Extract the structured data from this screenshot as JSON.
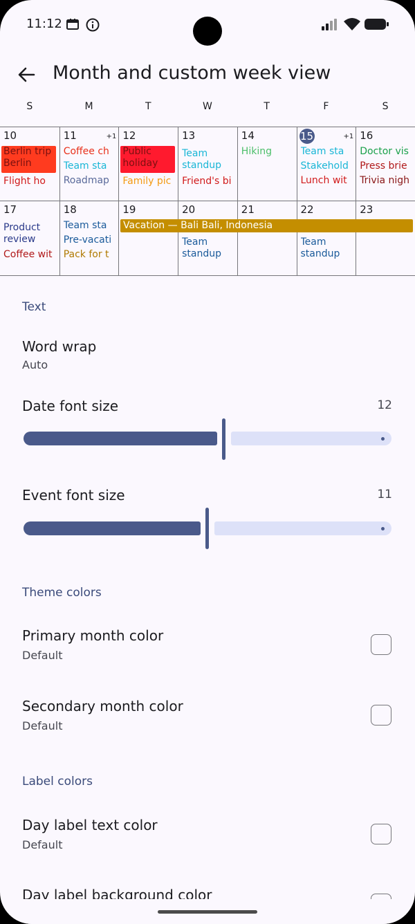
{
  "status": {
    "time": "11:12"
  },
  "header": {
    "title": "Month and custom week view"
  },
  "weekdays": [
    "S",
    "M",
    "T",
    "W",
    "T",
    "F",
    "S"
  ],
  "week1": {
    "days": [
      "10",
      "11",
      "12",
      "13",
      "14",
      "15",
      "16"
    ],
    "more_11": "+1",
    "more_15": "+1",
    "d10": {
      "box": "Berlin trip Berlin",
      "e1": "Flight ho"
    },
    "d11": {
      "e1": "Coffee ch",
      "e2": "Team sta",
      "e3": "Roadmap"
    },
    "d12": {
      "box": "Public holiday",
      "e1": "Family pic"
    },
    "d13": {
      "e1": "Team standup",
      "e2": "Friend's bi"
    },
    "d14": {
      "e1": "Hiking"
    },
    "d15": {
      "e1": "Team sta",
      "e2": "Stakehold",
      "e3": "Lunch wit"
    },
    "d16": {
      "e1": "Doctor vis",
      "e2": "Press brie",
      "e3": "Trivia nigh"
    }
  },
  "week2": {
    "days": [
      "17",
      "18",
      "19",
      "20",
      "21",
      "22",
      "23"
    ],
    "span_event": "Vacation — Bali Bali, Indonesia",
    "d17": {
      "e1": "Product review",
      "e2": "Coffee wit"
    },
    "d18": {
      "e1": "Team sta",
      "e2": "Pre-vacati",
      "e3": "Pack for t"
    },
    "d20": {
      "e1": "Team standup"
    },
    "d22": {
      "e1": "Team standup"
    }
  },
  "settings": {
    "text_section": "Text",
    "word_wrap": {
      "title": "Word wrap",
      "value": "Auto"
    },
    "date_font": {
      "title": "Date font size",
      "value": "12",
      "fraction": 0.55
    },
    "event_font": {
      "title": "Event font size",
      "value": "11",
      "fraction": 0.5
    },
    "theme_section": "Theme colors",
    "primary": {
      "title": "Primary month color",
      "value": "Default"
    },
    "secondary": {
      "title": "Secondary month color",
      "value": "Default"
    },
    "label_section": "Label colors",
    "day_label_text": {
      "title": "Day label text color",
      "value": "Default"
    },
    "day_label_bg": {
      "title": "Day label background color"
    }
  },
  "colors": {
    "accent": "#4a5a8a",
    "track_inactive": "#dde1f8",
    "background": "#fbf8fe"
  }
}
